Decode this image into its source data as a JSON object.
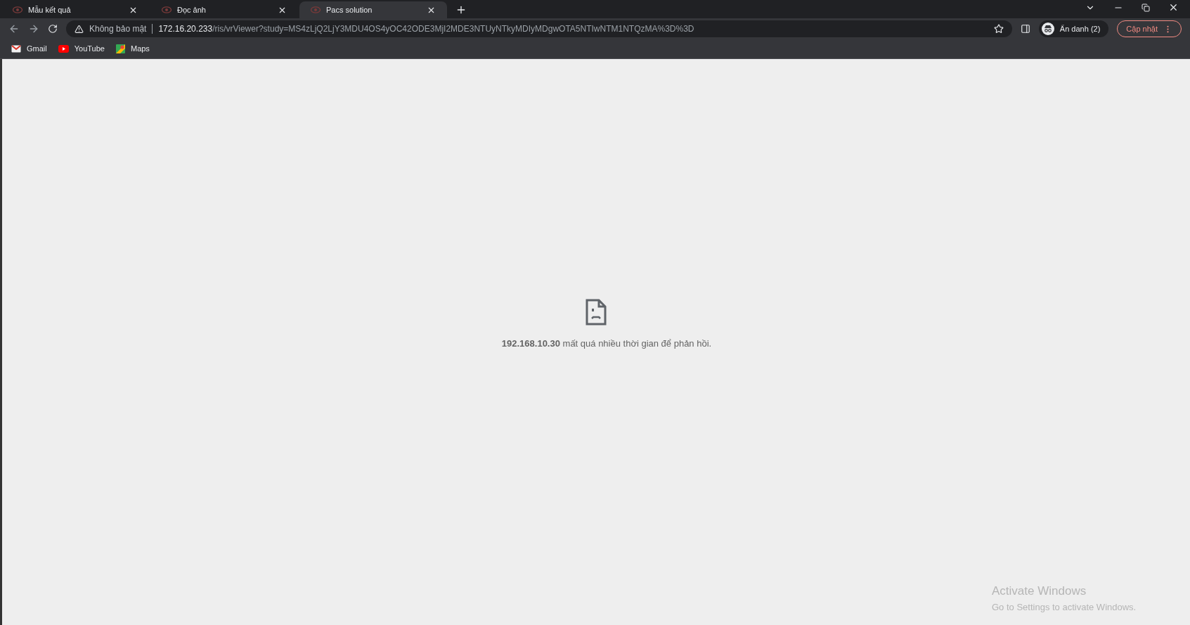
{
  "tabs": [
    {
      "title": "Mẫu kết quả",
      "selected": false
    },
    {
      "title": "Đọc ảnh",
      "selected": false
    },
    {
      "title": "Pacs solution",
      "selected": true
    }
  ],
  "address_bar": {
    "security_label": "Không bảo mật",
    "url_host": "172.16.20.233",
    "url_path": "/ris/vrViewer?study=MS4zLjQ2LjY3MDU4OS4yOC42ODE3MjI2MDE3NTUyNTkyMDIyMDgwOTA5NTIwNTM1NTQzMA%3D%3D"
  },
  "profile": {
    "label": "Ẩn danh (2)"
  },
  "update_button": {
    "label": "Cập nhật"
  },
  "bookmarks": [
    {
      "label": "Gmail",
      "kind": "gmail"
    },
    {
      "label": "YouTube",
      "kind": "youtube"
    },
    {
      "label": "Maps",
      "kind": "maps"
    }
  ],
  "error": {
    "message": "**192.168.10.30** mất quá nhiều thời gian để phản hồi."
  },
  "os_notice": {
    "title": "Activate Windows",
    "subtitle": "Go to Settings to activate Windows."
  }
}
